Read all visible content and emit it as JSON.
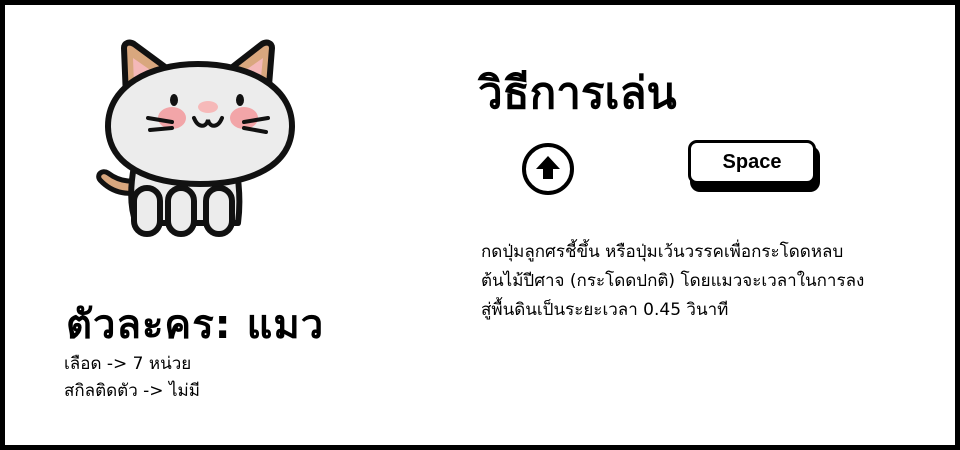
{
  "character": {
    "title": "ตัวละคร: แมว",
    "hp": "เลือด -> 7 หน่วย",
    "skill": "สกิลติดตัว -> ไม่มี",
    "icon": "cat-icon"
  },
  "howto": {
    "title": "วิธีการเล่น",
    "up_icon": "arrow-up-circle-icon",
    "space_label": "Space",
    "description_lines": [
      "กดปุ่มลูกศรชี้ขึ้น หรือปุ่มเว้นวรรคเพื่อกระโดดหลบ",
      "ต้นไม้ปีศาจ (กระโดดปกติ) โดยแมวจะเวลาในการลง",
      "สู่พื้นดินเป็นระยะเวลา 0.45 วินาที"
    ]
  },
  "colors": {
    "frame": "#000000",
    "background": "#ffffff",
    "cat_body": "#ececec",
    "cat_ear_outer": "#d9a77e",
    "cat_ear_inner": "#f4b8b8",
    "cat_blush": "#f2a5a8",
    "cat_nose": "#f6b9b9"
  }
}
